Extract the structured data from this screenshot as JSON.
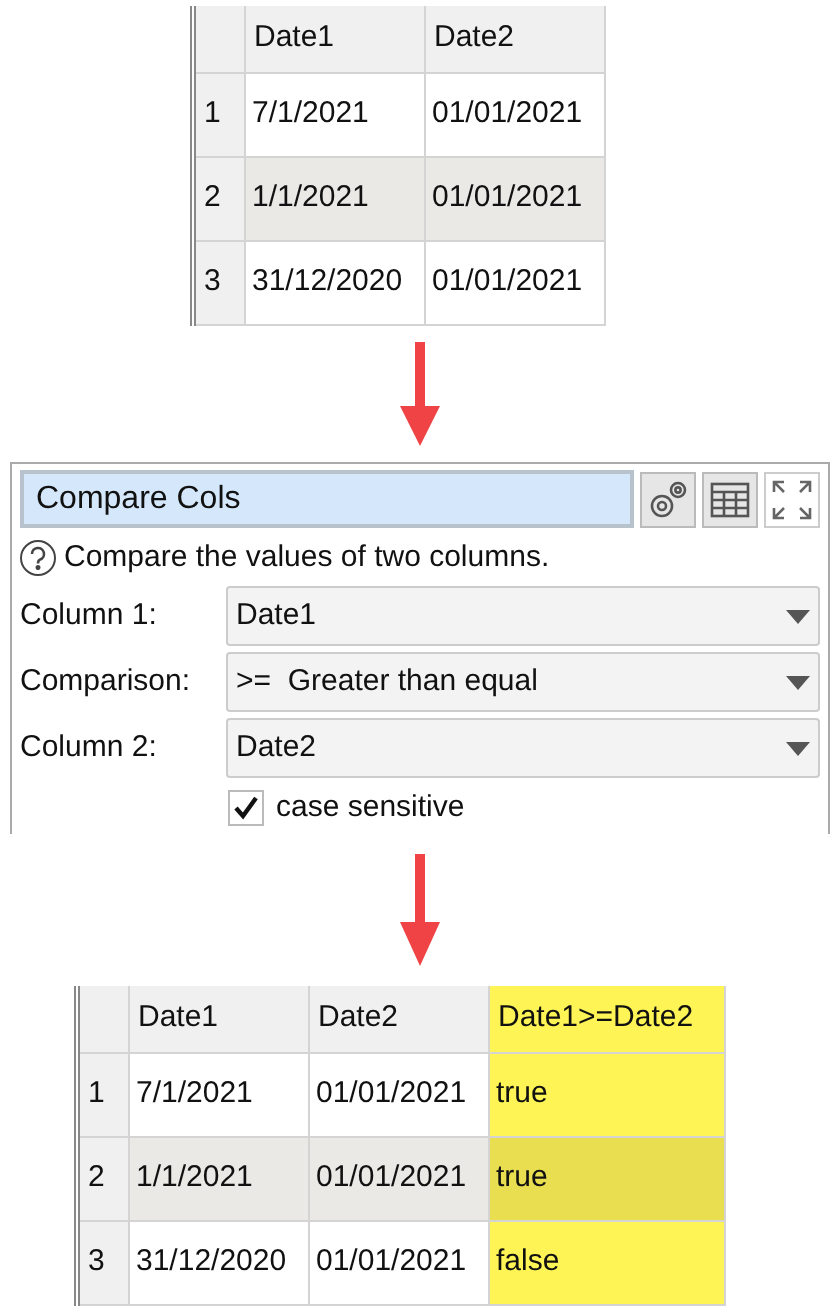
{
  "input_table": {
    "columns": [
      {
        "label": "Date1",
        "highlighted": false
      },
      {
        "label": "Date2",
        "highlighted": false
      }
    ],
    "rows": [
      {
        "number": "1",
        "cells": [
          "7/1/2021",
          "01/01/2021"
        ]
      },
      {
        "number": "2",
        "cells": [
          "1/1/2021",
          "01/01/2021"
        ]
      },
      {
        "number": "3",
        "cells": [
          "31/12/2020",
          "01/01/2021"
        ]
      }
    ]
  },
  "panel": {
    "title": "Compare Cols",
    "help": "Compare the values of two columns.",
    "fields": [
      {
        "label": "Column 1:",
        "value": "Date1"
      },
      {
        "label": "Comparison:",
        "value": ">=  Greater than equal"
      },
      {
        "label": "Column 2:",
        "value": "Date2"
      }
    ],
    "checkbox": {
      "label": "case sensitive",
      "checked": true
    }
  },
  "output_table": {
    "columns": [
      {
        "label": "Date1",
        "highlighted": false
      },
      {
        "label": "Date2",
        "highlighted": false
      },
      {
        "label": "Date1>=Date2",
        "highlighted": true
      }
    ],
    "rows": [
      {
        "number": "1",
        "cells": [
          "7/1/2021",
          "01/01/2021",
          "true"
        ]
      },
      {
        "number": "2",
        "cells": [
          "1/1/2021",
          "01/01/2021",
          "true"
        ]
      },
      {
        "number": "3",
        "cells": [
          "31/12/2020",
          "01/01/2021",
          "false"
        ]
      }
    ]
  }
}
